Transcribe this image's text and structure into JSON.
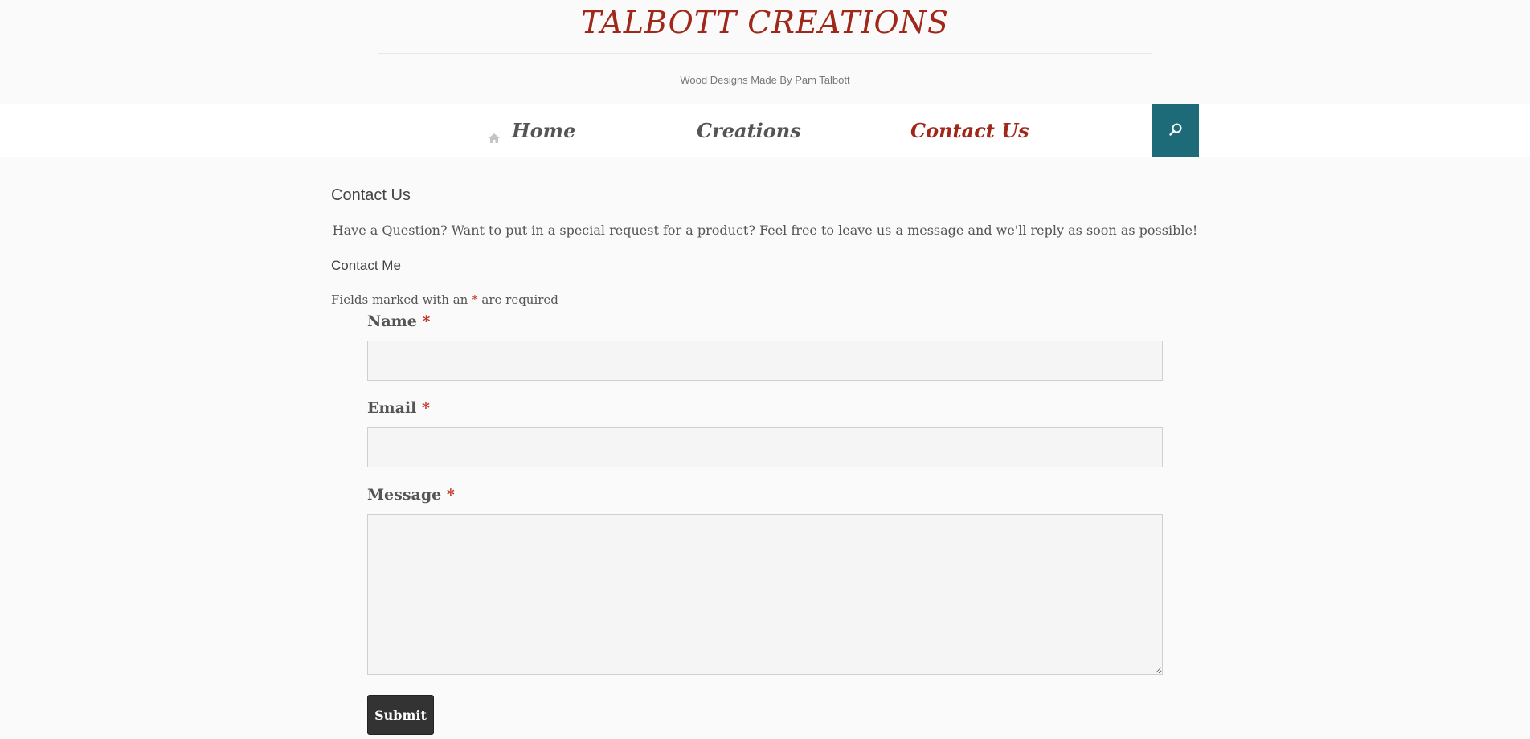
{
  "header": {
    "site_title": "TALBOTT CREATIONS",
    "tagline": "Wood Designs Made By Pam Talbott"
  },
  "nav": {
    "items": [
      {
        "label": "Home",
        "icon": "home-icon"
      },
      {
        "label": "Creations"
      },
      {
        "label": "Contact Us",
        "active": true
      }
    ],
    "search_icon": "search-icon"
  },
  "main": {
    "page_heading": "Contact Us",
    "intro": "Have a Question? Want to put in a special request for a product? Feel free to leave us a message and we'll reply as soon as possible!",
    "section_heading": "Contact Me",
    "required_note_before": "Fields marked with an",
    "required_star": "*",
    "required_note_after": "are required"
  },
  "form": {
    "name_label": "Name",
    "name_value": "",
    "email_label": "Email",
    "email_value": "",
    "message_label": "Message",
    "message_value": "",
    "required_marker": "*",
    "submit_label": "Submit"
  },
  "colors": {
    "accent": "#a0281a",
    "search_button": "#1d6a78",
    "submit_button": "#333333",
    "required_star": "#c0392b"
  }
}
